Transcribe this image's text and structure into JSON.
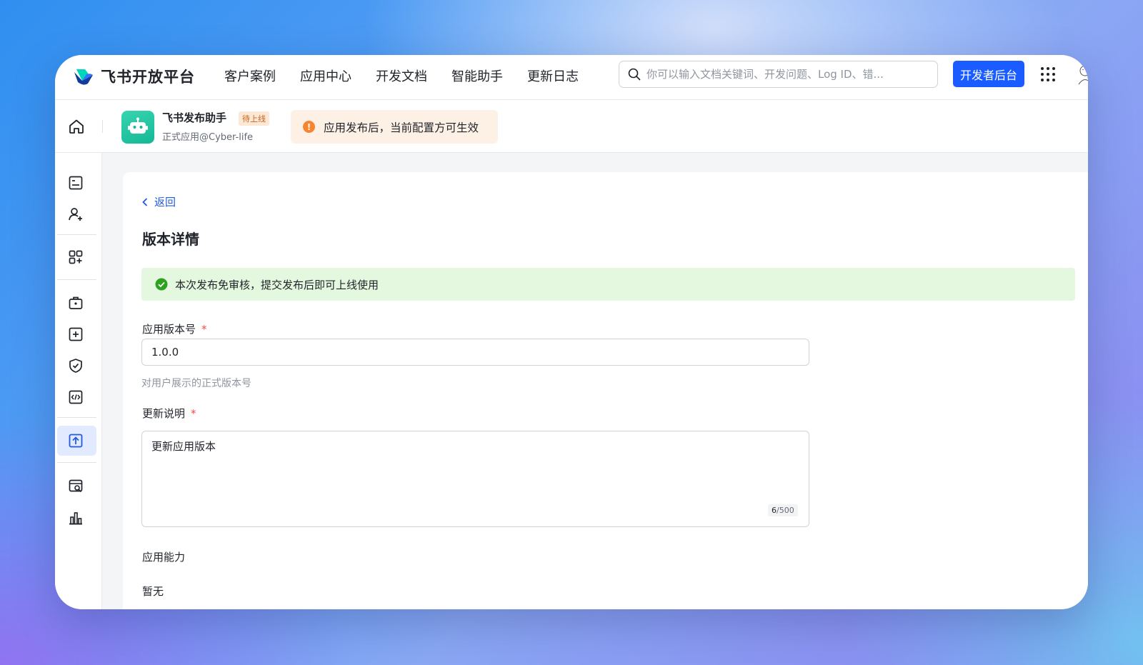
{
  "header": {
    "logo_text": "飞书开放平台",
    "nav": [
      "客户案例",
      "应用中心",
      "开发文档",
      "智能助手",
      "更新日志"
    ],
    "search_placeholder": "你可以输入文档关键词、开发问题、Log ID、错...",
    "dev_console_label": "开发者后台"
  },
  "app": {
    "name": "飞书发布助手",
    "status_badge": "待上线",
    "subtitle": "正式应用@Cyber-life",
    "notice": "应用发布后，当前配置方可生效"
  },
  "page": {
    "back_label": "返回",
    "title": "版本详情",
    "success_message": "本次发布免审核，提交发布后即可上线使用",
    "version_label": "应用版本号",
    "version_value": "1.0.0",
    "version_hint": "对用户展示的正式版本号",
    "release_notes_label": "更新说明",
    "release_notes_value": "更新应用版本",
    "char_count": "6",
    "char_limit": "/500",
    "capabilities_label": "应用能力",
    "capabilities_value": "暂无",
    "required_mark": "*"
  },
  "colors": {
    "primary": "#1a5cff",
    "link": "#245bdb",
    "success_bg": "#e4f8e0",
    "success_icon": "#2ea121",
    "warning_icon": "#f7852f",
    "required": "#f54a45",
    "app_icon": "#14b896"
  },
  "sidebar_icons": [
    "overview-icon",
    "member-icon",
    "add-feature-icon",
    "permission-icon",
    "event-icon",
    "security-icon",
    "dev-config-icon",
    "version-release-icon",
    "log-search-icon",
    "analytics-icon"
  ]
}
